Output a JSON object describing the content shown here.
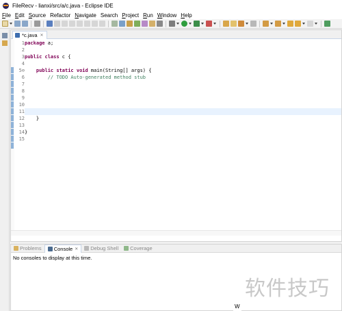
{
  "window": {
    "title": "FileRecv - lianxi/src/a/c.java - Eclipse IDE"
  },
  "menu": {
    "items": [
      {
        "label": "File",
        "mnemonic": "F",
        "rest": "ile"
      },
      {
        "label": "Edit",
        "mnemonic": "E",
        "rest": "dit"
      },
      {
        "label": "Source",
        "mnemonic": "S",
        "rest": "ource"
      },
      {
        "label": "Refactor",
        "mnemonic": "",
        "rest": "Refactor"
      },
      {
        "label": "Navigate",
        "mnemonic": "N",
        "rest": "avigate"
      },
      {
        "label": "Search",
        "mnemonic": "",
        "rest": "Search"
      },
      {
        "label": "Project",
        "mnemonic": "P",
        "rest": "roject"
      },
      {
        "label": "Run",
        "mnemonic": "R",
        "rest": "un"
      },
      {
        "label": "Window",
        "mnemonic": "W",
        "rest": "indow"
      },
      {
        "label": "Help",
        "mnemonic": "H",
        "rest": "elp"
      }
    ]
  },
  "editor": {
    "tab_label": "*c.java",
    "tab_close": "✕",
    "current_line": 11,
    "line_numbers": [
      "1",
      "2",
      "3",
      "4",
      "5⊖",
      "6",
      "7",
      "8",
      "9",
      "10",
      "11",
      "12",
      "13",
      "14",
      "15"
    ],
    "lines": [
      {
        "kw": "package",
        "text": " a;"
      },
      {
        "kw": "",
        "text": ""
      },
      {
        "kw": "public class",
        "text": " c {"
      },
      {
        "kw": "",
        "text": ""
      },
      {
        "kw": "    public static void",
        "text": " main(String[] args) {"
      },
      {
        "kw": "",
        "text": "",
        "comment": "        // TODO Auto-generated method stub"
      },
      {
        "kw": "",
        "text": ""
      },
      {
        "kw": "",
        "text": ""
      },
      {
        "kw": "",
        "text": ""
      },
      {
        "kw": "",
        "text": ""
      },
      {
        "kw": "",
        "text": ""
      },
      {
        "kw": "",
        "text": "    }"
      },
      {
        "kw": "",
        "text": ""
      },
      {
        "kw": "",
        "text": "}"
      },
      {
        "kw": "",
        "text": ""
      }
    ]
  },
  "bottom_panel": {
    "tabs": [
      {
        "label": "Problems",
        "active": false
      },
      {
        "label": "Console",
        "active": true
      },
      {
        "label": "Debug Shell",
        "active": false
      },
      {
        "label": "Coverage",
        "active": false
      }
    ],
    "console_tab_close": "✕",
    "message": "No consoles to display at this time."
  },
  "watermark": "软件技巧",
  "status_fragment": "W",
  "colors": {
    "keyword": "#7f0055",
    "comment": "#3f7f5f",
    "current_line_bg": "#e8f2fe"
  }
}
